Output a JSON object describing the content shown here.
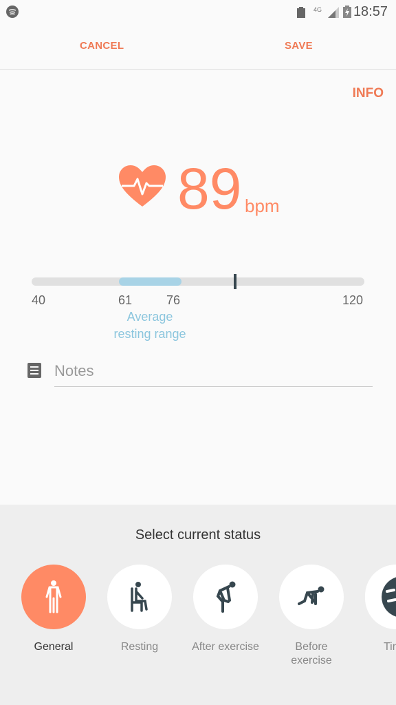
{
  "status_bar": {
    "time": "18:57",
    "network": "4G"
  },
  "toolbar": {
    "cancel": "CANCEL",
    "save": "SAVE"
  },
  "info": "INFO",
  "reading": {
    "value": "89",
    "unit": "bpm"
  },
  "scale": {
    "min": "40",
    "max": "120",
    "range_low": "61",
    "range_high": "76",
    "range_label_1": "Average",
    "range_label_2": "resting range",
    "min_value": 40,
    "max_value": 120,
    "low_value": 61,
    "high_value": 76,
    "current": 89,
    "range_color": "#a8d3e6"
  },
  "notes": {
    "placeholder": "Notes"
  },
  "status_panel": {
    "title": "Select current status",
    "options": [
      {
        "label": "General",
        "selected": true
      },
      {
        "label": "Resting"
      },
      {
        "label": "After exercise"
      },
      {
        "label": "Before",
        "label2": "exercise"
      },
      {
        "label": "Tired"
      }
    ]
  },
  "colors": {
    "accent": "#ff8a65",
    "text_accent": "#ef7a55"
  }
}
